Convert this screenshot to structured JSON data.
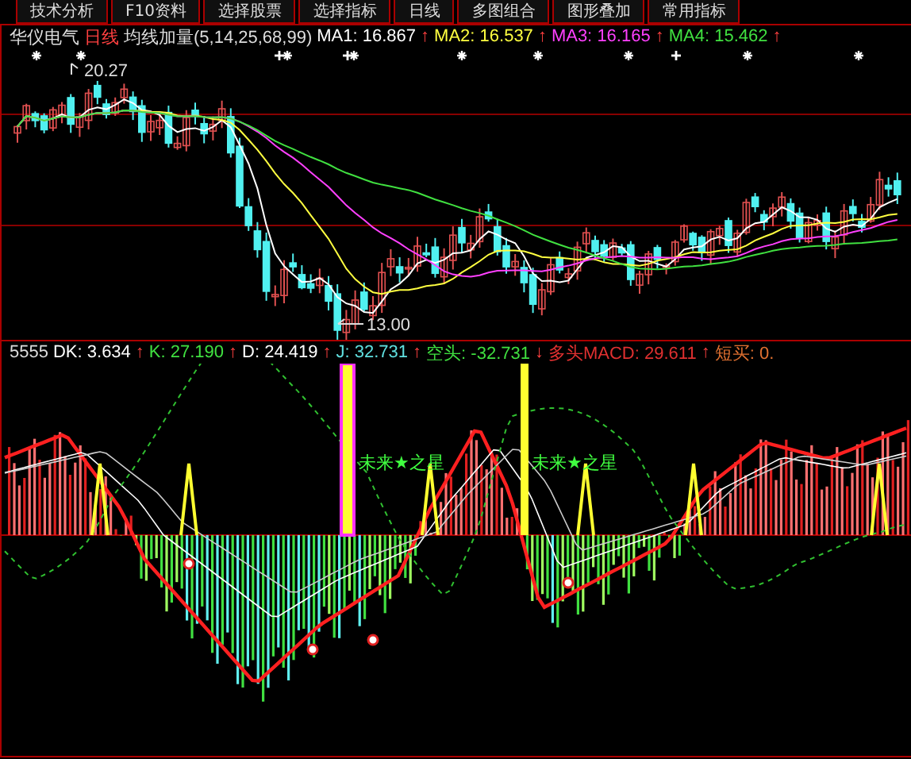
{
  "toolbar": {
    "tabs": [
      {
        "label": "技术分析"
      },
      {
        "label": "F10资料"
      },
      {
        "label": "选择股票"
      },
      {
        "label": "选择指标"
      },
      {
        "label": "日线"
      },
      {
        "label": "多图组合"
      },
      {
        "label": "图形叠加"
      },
      {
        "label": "常用指标"
      }
    ]
  },
  "price_panel": {
    "stock": "华仪电气",
    "period": "日线",
    "indicator": "均线加量(5,14,25,68,99)",
    "ma": [
      {
        "label": "MA1:",
        "value": "16.867",
        "arrow": "↑",
        "color": "#ffffff"
      },
      {
        "label": "MA2:",
        "value": "16.537",
        "arrow": "↑",
        "color": "#ffff40"
      },
      {
        "label": "MA3:",
        "value": "16.165",
        "arrow": "↑",
        "color": "#ff40ff"
      },
      {
        "label": "MA4:",
        "value": "15.462",
        "arrow": "↑",
        "color": "#40e040"
      }
    ],
    "high_label": "20.27",
    "low_label": "13.00"
  },
  "indicator_panel": {
    "code": "5555",
    "values": [
      {
        "label": "DK:",
        "value": "3.634",
        "arrow": "↑",
        "color": "#ffffff"
      },
      {
        "label": "K:",
        "value": "27.190",
        "arrow": "↑",
        "color": "#40e040"
      },
      {
        "label": "D:",
        "value": "24.419",
        "arrow": "↑",
        "color": "#ffffff"
      },
      {
        "label": "J:",
        "value": "32.731",
        "arrow": "↑",
        "color": "#60e0e0"
      },
      {
        "label": "空头:",
        "value": "-32.731",
        "arrow": "↓",
        "color": "#40e040"
      },
      {
        "label": "多头MACD:",
        "value": "29.611",
        "arrow": "↑",
        "color": "#e03030"
      },
      {
        "label": "短买:",
        "value": "0.",
        "color": "#e07030"
      }
    ],
    "markers": [
      "未来★之星",
      "未来★之星"
    ]
  }
}
